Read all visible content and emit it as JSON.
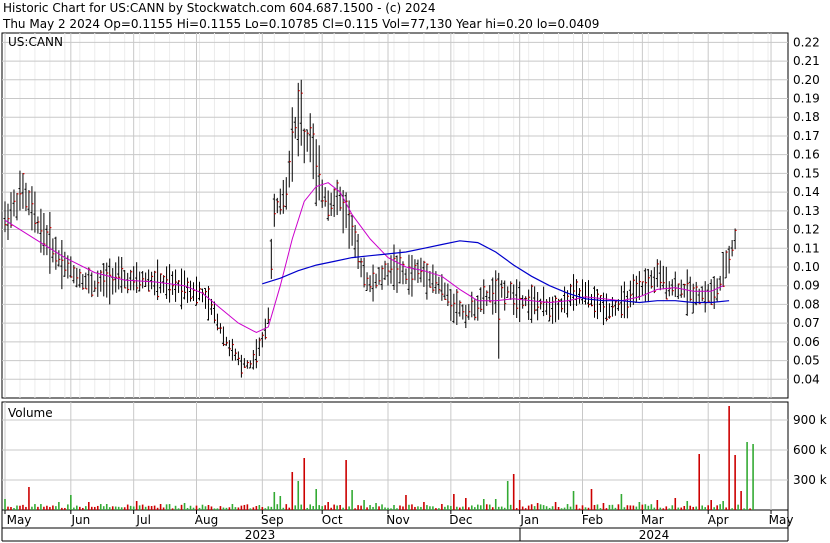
{
  "header": {
    "line1": "Historic Chart for US:CANN by Stockwatch.com 604.687.1500 - (c) 2024",
    "line2": "Thu May  2 2024   Op=0.1155   Hi=0.1155   Lo=0.10785   Cl=0.115   Vol=77,130   Year hi=0.20   lo=0.0409"
  },
  "chart_data": [
    {
      "type": "ohlc",
      "symbol_label": "US:CANN",
      "ylim": [
        0.03,
        0.225
      ],
      "y_ticks": [
        "0.04",
        "0.05",
        "0.06",
        "0.07",
        "0.08",
        "0.09",
        "0.10",
        "0.11",
        "0.12",
        "0.13",
        "0.14",
        "0.15",
        "0.16",
        "0.17",
        "0.18",
        "0.19",
        "0.20",
        "0.21",
        "0.22"
      ],
      "x_months": [
        "May",
        "Jun",
        "Jul",
        "Aug",
        "Sep",
        "Oct",
        "Nov",
        "Dec",
        "Jan",
        "Feb",
        "Mar",
        "Apr",
        "May"
      ],
      "x_years": [
        "2023",
        "2024"
      ],
      "grid": true,
      "series": [
        {
          "key": "price",
          "color": "#000000"
        },
        {
          "key": "ma_short",
          "color": "#cc00cc"
        },
        {
          "key": "ma_long",
          "color": "#0000cc"
        }
      ],
      "price_anchors": [
        [
          0,
          0.125
        ],
        [
          6,
          0.14
        ],
        [
          12,
          0.12
        ],
        [
          18,
          0.105
        ],
        [
          24,
          0.095
        ],
        [
          30,
          0.09
        ],
        [
          36,
          0.095
        ],
        [
          42,
          0.092
        ],
        [
          48,
          0.093
        ],
        [
          54,
          0.09
        ],
        [
          60,
          0.09
        ],
        [
          66,
          0.085
        ],
        [
          70,
          0.075
        ],
        [
          74,
          0.06
        ],
        [
          78,
          0.05
        ],
        [
          82,
          0.048
        ],
        [
          86,
          0.06
        ],
        [
          88,
          0.075
        ],
        [
          90,
          0.13
        ],
        [
          94,
          0.14
        ],
        [
          96,
          0.17
        ],
        [
          98,
          0.18
        ],
        [
          100,
          0.165
        ],
        [
          102,
          0.17
        ],
        [
          104,
          0.15
        ],
        [
          106,
          0.14
        ],
        [
          108,
          0.135
        ],
        [
          112,
          0.135
        ],
        [
          114,
          0.13
        ],
        [
          116,
          0.12
        ],
        [
          118,
          0.105
        ],
        [
          122,
          0.09
        ],
        [
          126,
          0.095
        ],
        [
          130,
          0.1
        ],
        [
          134,
          0.095
        ],
        [
          138,
          0.098
        ],
        [
          142,
          0.095
        ],
        [
          146,
          0.088
        ],
        [
          150,
          0.08
        ],
        [
          154,
          0.075
        ],
        [
          158,
          0.08
        ],
        [
          162,
          0.085
        ],
        [
          166,
          0.088
        ],
        [
          170,
          0.085
        ],
        [
          174,
          0.082
        ],
        [
          178,
          0.08
        ],
        [
          182,
          0.078
        ],
        [
          186,
          0.08
        ],
        [
          190,
          0.085
        ],
        [
          194,
          0.085
        ],
        [
          198,
          0.08
        ],
        [
          202,
          0.078
        ],
        [
          206,
          0.08
        ],
        [
          210,
          0.085
        ],
        [
          214,
          0.09
        ],
        [
          218,
          0.095
        ],
        [
          222,
          0.09
        ],
        [
          226,
          0.088
        ],
        [
          230,
          0.086
        ],
        [
          234,
          0.085
        ],
        [
          238,
          0.087
        ],
        [
          241,
          0.1
        ],
        [
          244,
          0.115
        ]
      ],
      "ma_short_points": [
        [
          0,
          0.125
        ],
        [
          10,
          0.115
        ],
        [
          20,
          0.105
        ],
        [
          30,
          0.097
        ],
        [
          40,
          0.093
        ],
        [
          50,
          0.092
        ],
        [
          60,
          0.09
        ],
        [
          66,
          0.086
        ],
        [
          72,
          0.078
        ],
        [
          78,
          0.07
        ],
        [
          84,
          0.065
        ],
        [
          88,
          0.068
        ],
        [
          92,
          0.09
        ],
        [
          96,
          0.115
        ],
        [
          100,
          0.135
        ],
        [
          104,
          0.143
        ],
        [
          108,
          0.145
        ],
        [
          112,
          0.14
        ],
        [
          116,
          0.128
        ],
        [
          122,
          0.115
        ],
        [
          128,
          0.105
        ],
        [
          134,
          0.1
        ],
        [
          140,
          0.098
        ],
        [
          146,
          0.095
        ],
        [
          152,
          0.088
        ],
        [
          158,
          0.082
        ],
        [
          164,
          0.082
        ],
        [
          170,
          0.083
        ],
        [
          176,
          0.082
        ],
        [
          182,
          0.081
        ],
        [
          188,
          0.082
        ],
        [
          194,
          0.084
        ],
        [
          200,
          0.083
        ],
        [
          206,
          0.082
        ],
        [
          212,
          0.084
        ],
        [
          218,
          0.088
        ],
        [
          224,
          0.089
        ],
        [
          230,
          0.087
        ],
        [
          236,
          0.087
        ],
        [
          240,
          0.09
        ]
      ],
      "ma_long_points": [
        [
          86,
          0.091
        ],
        [
          92,
          0.094
        ],
        [
          98,
          0.098
        ],
        [
          104,
          0.101
        ],
        [
          110,
          0.103
        ],
        [
          116,
          0.105
        ],
        [
          122,
          0.106
        ],
        [
          128,
          0.107
        ],
        [
          134,
          0.108
        ],
        [
          140,
          0.11
        ],
        [
          146,
          0.112
        ],
        [
          152,
          0.114
        ],
        [
          158,
          0.113
        ],
        [
          164,
          0.108
        ],
        [
          170,
          0.101
        ],
        [
          176,
          0.095
        ],
        [
          182,
          0.09
        ],
        [
          188,
          0.086
        ],
        [
          194,
          0.083
        ],
        [
          200,
          0.082
        ],
        [
          206,
          0.082
        ],
        [
          212,
          0.081
        ],
        [
          218,
          0.082
        ],
        [
          224,
          0.082
        ],
        [
          230,
          0.081
        ],
        [
          236,
          0.081
        ],
        [
          242,
          0.082
        ]
      ]
    },
    {
      "type": "bar",
      "title": "Volume",
      "ylim": [
        0,
        1080000
      ],
      "y_ticks": [
        "300 k",
        "600 k",
        "900 k"
      ],
      "tick_values": [
        300000,
        600000,
        900000
      ],
      "spikes": [
        [
          0,
          110000
        ],
        [
          8,
          230000
        ],
        [
          18,
          80000
        ],
        [
          22,
          150000
        ],
        [
          28,
          80000
        ],
        [
          34,
          60000
        ],
        [
          44,
          90000
        ],
        [
          52,
          60000
        ],
        [
          60,
          70000
        ],
        [
          68,
          50000
        ],
        [
          76,
          60000
        ],
        [
          84,
          40000
        ],
        [
          90,
          180000
        ],
        [
          92,
          140000
        ],
        [
          96,
          380000
        ],
        [
          98,
          290000
        ],
        [
          100,
          520000
        ],
        [
          104,
          210000
        ],
        [
          108,
          80000
        ],
        [
          114,
          500000
        ],
        [
          116,
          200000
        ],
        [
          120,
          100000
        ],
        [
          124,
          70000
        ],
        [
          130,
          50000
        ],
        [
          134,
          150000
        ],
        [
          140,
          80000
        ],
        [
          146,
          60000
        ],
        [
          150,
          160000
        ],
        [
          154,
          120000
        ],
        [
          160,
          110000
        ],
        [
          164,
          110000
        ],
        [
          168,
          290000
        ],
        [
          170,
          360000
        ],
        [
          172,
          100000
        ],
        [
          178,
          70000
        ],
        [
          184,
          80000
        ],
        [
          190,
          190000
        ],
        [
          196,
          210000
        ],
        [
          200,
          70000
        ],
        [
          206,
          160000
        ],
        [
          212,
          80000
        ],
        [
          218,
          100000
        ],
        [
          224,
          120000
        ],
        [
          228,
          90000
        ],
        [
          232,
          560000
        ],
        [
          236,
          100000
        ],
        [
          240,
          90000
        ],
        [
          242,
          1040000
        ],
        [
          244,
          550000
        ],
        [
          246,
          190000
        ],
        [
          248,
          680000
        ],
        [
          250,
          660000
        ]
      ]
    }
  ]
}
